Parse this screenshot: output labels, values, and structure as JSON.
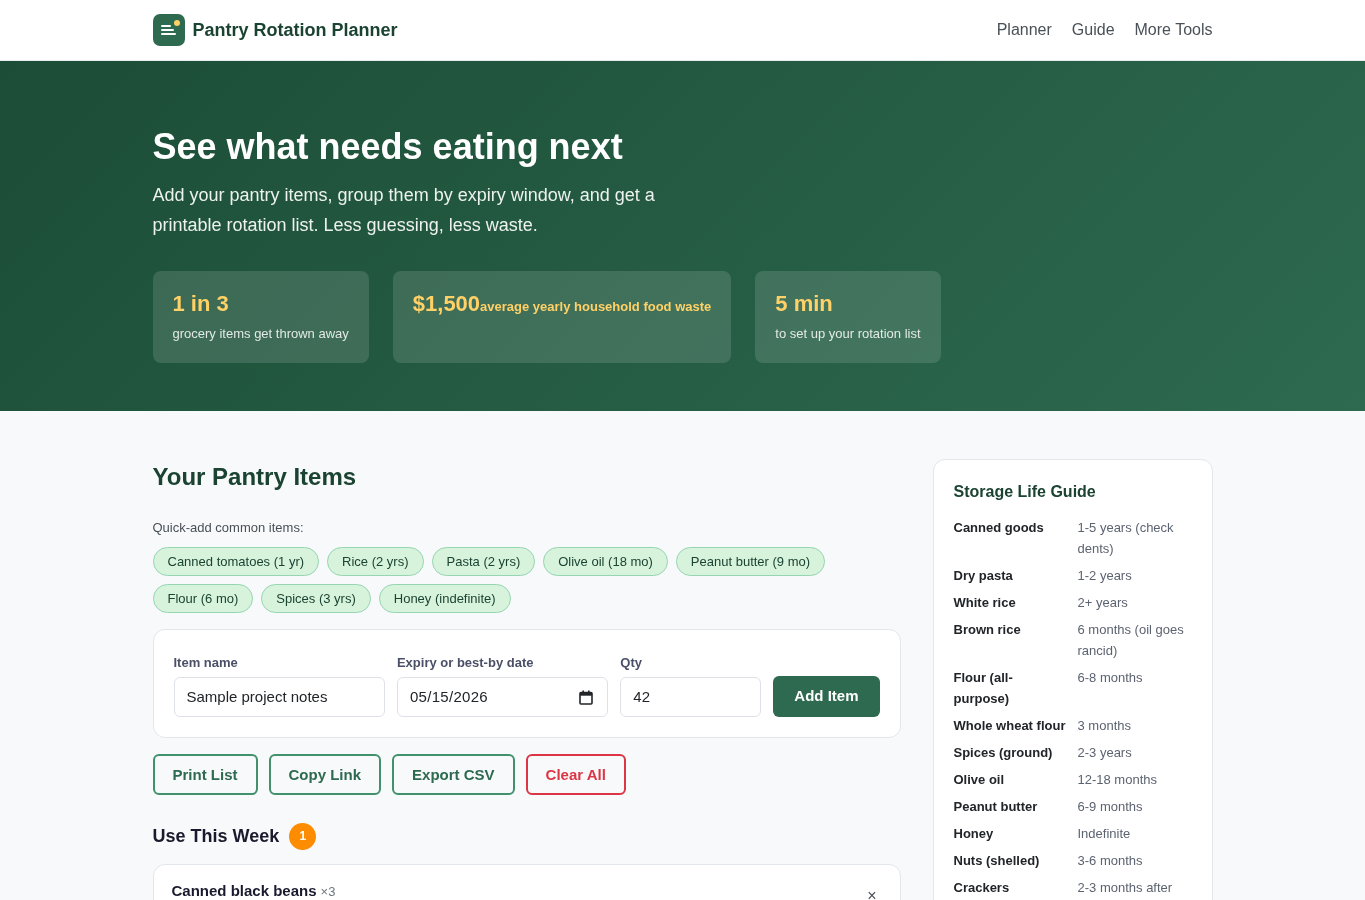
{
  "header": {
    "brand": "Pantry Rotation Planner",
    "nav": [
      {
        "label": "Planner"
      },
      {
        "label": "Guide"
      },
      {
        "label": "More Tools"
      }
    ]
  },
  "hero": {
    "title": "See what needs eating next",
    "lead": "Add your pantry items, group them by expiry window, and get a printable rotation list. Less guessing, less waste.",
    "stats": [
      {
        "kind": "stacked",
        "value": "1 in 3",
        "label": "grocery items get thrown away"
      },
      {
        "kind": "inline",
        "value": "$1,500",
        "label": "average yearly household food waste"
      },
      {
        "kind": "stacked",
        "value": "5 min",
        "label": "to set up your rotation list"
      }
    ]
  },
  "pantry": {
    "title": "Your Pantry Items",
    "quick_add_label": "Quick-add common items:",
    "quick_add": [
      "Canned tomatoes (1 yr)",
      "Rice (2 yrs)",
      "Pasta (2 yrs)",
      "Olive oil (18 mo)",
      "Peanut butter (9 mo)",
      "Flour (6 mo)",
      "Spices (3 yrs)",
      "Honey (indefinite)"
    ],
    "form": {
      "fields": [
        {
          "kind": "text",
          "label": "Item name",
          "value": "Sample project notes"
        },
        {
          "kind": "date",
          "label": "Expiry or best-by date",
          "value": "05/15/2026"
        },
        {
          "kind": "number",
          "label": "Qty",
          "value": "42"
        }
      ],
      "submit": "Add Item"
    },
    "actions": [
      {
        "kind": "outline",
        "label": "Print List"
      },
      {
        "kind": "outline",
        "label": "Copy Link"
      },
      {
        "kind": "outline",
        "label": "Export CSV"
      },
      {
        "kind": "danger",
        "label": "Clear All"
      }
    ],
    "groups": [
      {
        "title": "Use This Week",
        "count": "1",
        "color": "#fd8c00",
        "items": [
          {
            "name": "Canned black beans",
            "qty": "×3",
            "remove": "×"
          }
        ]
      }
    ]
  },
  "guide": {
    "title": "Storage Life Guide",
    "rows": [
      {
        "item": "Canned goods",
        "life": "1-5 years (check dents)"
      },
      {
        "item": "Dry pasta",
        "life": "1-2 years"
      },
      {
        "item": "White rice",
        "life": "2+ years"
      },
      {
        "item": "Brown rice",
        "life": "6 months (oil goes rancid)"
      },
      {
        "item": "Flour (all-purpose)",
        "life": "6-8 months"
      },
      {
        "item": "Whole wheat flour",
        "life": "3 months"
      },
      {
        "item": "Spices (ground)",
        "life": "2-3 years"
      },
      {
        "item": "Olive oil",
        "life": "12-18 months"
      },
      {
        "item": "Peanut butter",
        "life": "6-9 months"
      },
      {
        "item": "Honey",
        "life": "Indefinite"
      },
      {
        "item": "Nuts (shelled)",
        "life": "3-6 months"
      },
      {
        "item": "Crackers",
        "life": "2-3 months after"
      }
    ]
  }
}
